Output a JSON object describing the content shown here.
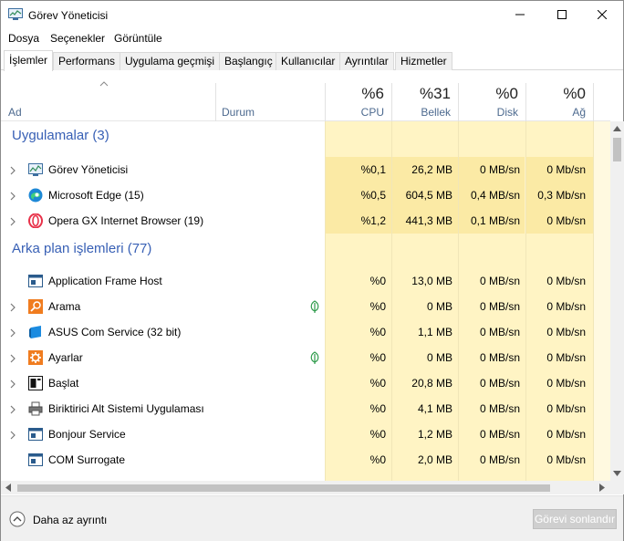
{
  "window": {
    "title": "Görev Yöneticisi"
  },
  "menu": [
    "Dosya",
    "Seçenekler",
    "Görüntüle"
  ],
  "tabs": [
    "İşlemler",
    "Performans",
    "Uygulama geçmişi",
    "Başlangıç",
    "Kullanıcılar",
    "Ayrıntılar",
    "Hizmetler"
  ],
  "active_tab": "İşlemler",
  "columns": {
    "name": "Ad",
    "status": "Durum",
    "cpu": {
      "percent": "%6",
      "label": "CPU"
    },
    "memory": {
      "percent": "%31",
      "label": "Bellek"
    },
    "disk": {
      "percent": "%0",
      "label": "Disk"
    },
    "network": {
      "percent": "%0",
      "label": "Ağ"
    }
  },
  "groups": [
    {
      "title": "Uygulamalar (3)",
      "rows": [
        {
          "name": "Görev Yöneticisi",
          "icon": "task-manager-icon",
          "cpu": "%0,1",
          "memory": "26,2 MB",
          "disk": "0 MB/sn",
          "network": "0 Mb/sn"
        },
        {
          "name": "Microsoft Edge (15)",
          "icon": "edge-icon",
          "cpu": "%0,5",
          "memory": "604,5 MB",
          "disk": "0,4 MB/sn",
          "network": "0,3 Mb/sn"
        },
        {
          "name": "Opera GX Internet Browser (19)",
          "icon": "opera-icon",
          "cpu": "%1,2",
          "memory": "441,3 MB",
          "disk": "0,1 MB/sn",
          "network": "0 Mb/sn"
        }
      ]
    },
    {
      "title": "Arka plan işlemleri (77)",
      "rows": [
        {
          "name": "Application Frame Host",
          "icon": "window-icon",
          "cpu": "%0",
          "memory": "13,0 MB",
          "disk": "0 MB/sn",
          "network": "0 Mb/sn"
        },
        {
          "name": "Arama",
          "icon": "search-icon",
          "cpu": "%0",
          "memory": "0 MB",
          "disk": "0 MB/sn",
          "network": "0 Mb/sn"
        },
        {
          "name": "ASUS Com Service (32 bit)",
          "icon": "asus-icon",
          "cpu": "%0",
          "memory": "1,1 MB",
          "disk": "0 MB/sn",
          "network": "0 Mb/sn"
        },
        {
          "name": "Ayarlar",
          "icon": "gear-icon",
          "cpu": "%0",
          "memory": "0 MB",
          "disk": "0 MB/sn",
          "network": "0 Mb/sn"
        },
        {
          "name": "Başlat",
          "icon": "start-icon",
          "cpu": "%0",
          "memory": "20,8 MB",
          "disk": "0 MB/sn",
          "network": "0 Mb/sn"
        },
        {
          "name": "Biriktirici Alt Sistemi Uygulaması",
          "icon": "printer-icon",
          "cpu": "%0",
          "memory": "4,1 MB",
          "disk": "0 MB/sn",
          "network": "0 Mb/sn"
        },
        {
          "name": "Bonjour Service",
          "icon": "window-icon",
          "cpu": "%0",
          "memory": "1,2 MB",
          "disk": "0 MB/sn",
          "network": "0 Mb/sn"
        },
        {
          "name": "COM Surrogate",
          "icon": "window-icon",
          "cpu": "%0",
          "memory": "2,0 MB",
          "disk": "0 MB/sn",
          "network": "0 Mb/sn"
        }
      ]
    }
  ],
  "footer": {
    "less_details": "Daha az ayrıntı",
    "end_task": "Görevi sonlandır"
  },
  "colors": {
    "group_title": "#3860b5",
    "cpu_highlight": "#fbeaa5",
    "cell_light": "#fff4c4",
    "column_header_label": "#4d6a8f"
  }
}
